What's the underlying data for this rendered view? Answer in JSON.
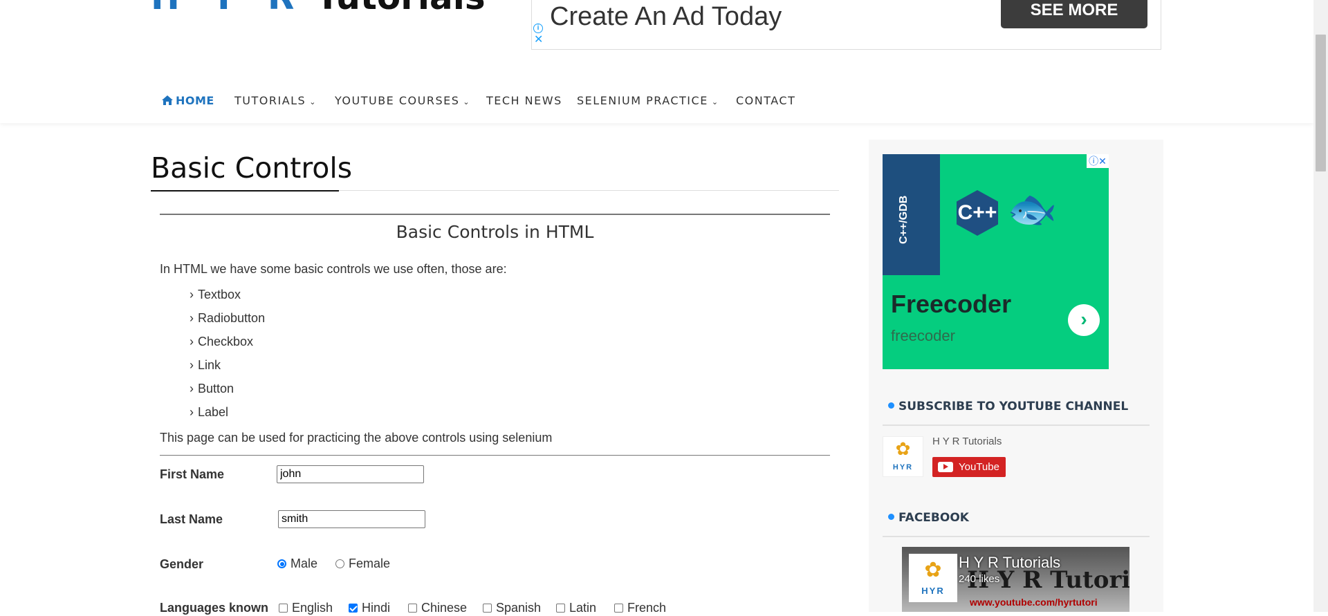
{
  "header": {
    "logo_hyr": "H Y R",
    "logo_tutorials": "Tutorials",
    "ad": {
      "headline": "Create An Ad Today",
      "button": "SEE MORE",
      "info": "i",
      "close": "✕"
    },
    "nav": [
      {
        "label": "HOME",
        "icon": "home-icon",
        "has_dropdown": false,
        "active": true
      },
      {
        "label": "TUTORIALS",
        "has_dropdown": true
      },
      {
        "label": "YOUTUBE COURSES",
        "has_dropdown": true
      },
      {
        "label": "TECH NEWS",
        "has_dropdown": false
      },
      {
        "label": "SELENIUM PRACTICE",
        "has_dropdown": true
      },
      {
        "label": "CONTACT",
        "has_dropdown": false
      }
    ]
  },
  "main": {
    "page_title": "Basic Controls",
    "section_title": "Basic Controls in HTML",
    "intro": "In HTML we have some basic controls we use often, those are:",
    "controls": [
      "Textbox",
      "Radiobutton",
      "Checkbox",
      "Link",
      "Button",
      "Label"
    ],
    "note": "This page can be used for practicing the above controls using selenium",
    "form": {
      "first_name_label": "First Name",
      "first_name_value": "john",
      "last_name_label": "Last Name",
      "last_name_value": "smith",
      "gender_label": "Gender",
      "gender_options": [
        {
          "label": "Male",
          "checked": true
        },
        {
          "label": "Female",
          "checked": false
        }
      ],
      "languages_label": "Languages known",
      "languages": [
        {
          "label": "English",
          "checked": false
        },
        {
          "label": "Hindi",
          "checked": true
        },
        {
          "label": "Chinese",
          "checked": false
        },
        {
          "label": "Spanish",
          "checked": false
        },
        {
          "label": "Latin",
          "checked": false
        },
        {
          "label": "French",
          "checked": false
        }
      ]
    }
  },
  "sidebar": {
    "ad": {
      "vertical_text": "C++/GDB",
      "logo_text": "C++",
      "brand": "Freecoder",
      "sub": "freecoder",
      "go": "›",
      "adchoices": "ⓘ✕"
    },
    "youtube_widget": {
      "title": "SUBSCRIBE TO YOUTUBE CHANNEL",
      "channel_name": "H Y R Tutorials",
      "logo_letters": "HYR",
      "button": "YouTube"
    },
    "facebook_widget": {
      "title": "FACEBOOK",
      "page_name": "H Y R Tutorials",
      "likes": "240 likes",
      "cover_text": "H Y R Tutoria",
      "cover_url": "www.youtube.com/hyrtutori",
      "logo_letters": "HYR"
    }
  },
  "colors": {
    "brand_blue": "#1e73be",
    "ad_green": "#05cd7f",
    "youtube_red": "#d32323",
    "checked_blue": "#0075ff"
  }
}
